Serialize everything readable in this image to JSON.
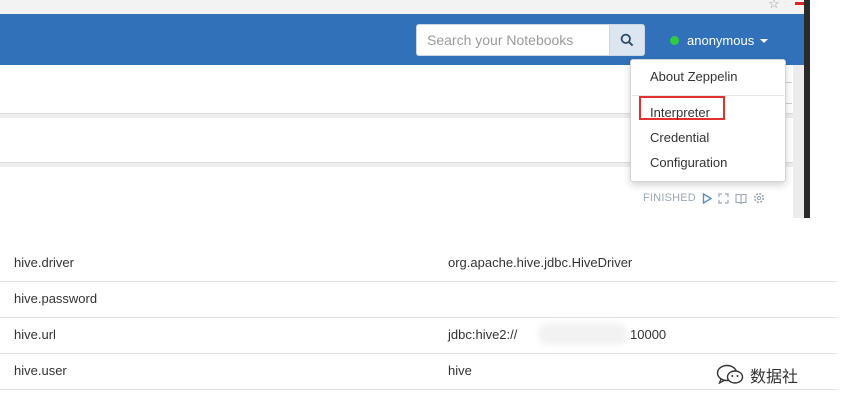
{
  "navbar": {
    "search_placeholder": "Search your Notebooks",
    "user_name": "anonymous",
    "brand_color": "#3071b9",
    "status_color": "#2ecc40"
  },
  "dropdown": {
    "items": [
      "About Zeppelin",
      "Interpreter",
      "Credential",
      "Configuration"
    ],
    "highlighted": "Interpreter",
    "highlight_color": "#e53030"
  },
  "paragraph": {
    "status": "FINISHED",
    "icons": [
      "run-icon",
      "expand-icon",
      "book-icon",
      "settings-icon"
    ]
  },
  "properties": [
    {
      "name": "hive.driver",
      "value": "org.apache.hive.jdbc.HiveDriver"
    },
    {
      "name": "hive.password",
      "value": ""
    },
    {
      "name": "hive.url",
      "value": "jdbc:hive2://",
      "value_tail": "10000"
    },
    {
      "name": "hive.user",
      "value": "hive"
    }
  ],
  "watermark": {
    "text": "数据社",
    "icon": "wechat-icon"
  }
}
